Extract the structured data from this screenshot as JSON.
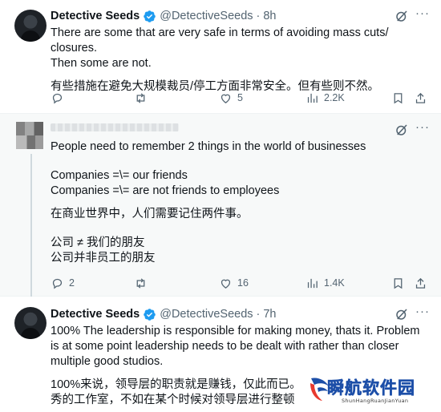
{
  "tweets": [
    {
      "author": "Detective Seeds",
      "handle": "@DetectiveSeeds",
      "time": "8h",
      "paragraphs": [
        "There are some that are very safe in terms of avoiding mass cuts/ closures.\nThen some are not.",
        "有些措施在避免大规模裁员/停工方面非常安全。但有些则不然。"
      ],
      "replies": "",
      "retweets": "",
      "likes": "5",
      "views": "2.2K"
    },
    {
      "author": "",
      "handle": "",
      "time": "",
      "paragraphs": [
        "People need to remember 2 things in the world of businesses",
        "Companies =\\= our friends\nCompanies =\\= are not friends to employees",
        "在商业世界中，人们需要记住两件事。",
        "公司 ≠ 我们的朋友\n公司并非员工的朋友"
      ],
      "replies": "2",
      "retweets": "",
      "likes": "16",
      "views": "1.4K"
    },
    {
      "author": "Detective Seeds",
      "handle": "@DetectiveSeeds",
      "time": "7h",
      "paragraphs": [
        "100% The leadership is responsible for making money, thats it. Problem is at some point leadership needs to be dealt with rather than closer multiple good studios.",
        "100%来说，领导层的职责就是赚钱，仅此而已。\n秀的工作室，不如在某个时候对领导层进行整顿"
      ]
    }
  ],
  "watermark": {
    "title": "瞬航软件园",
    "subtitle": "ShunHangRuanJianYuan"
  },
  "colors": {
    "verified": "#1d9bf0",
    "muted": "#536471",
    "text": "#0f1419"
  }
}
